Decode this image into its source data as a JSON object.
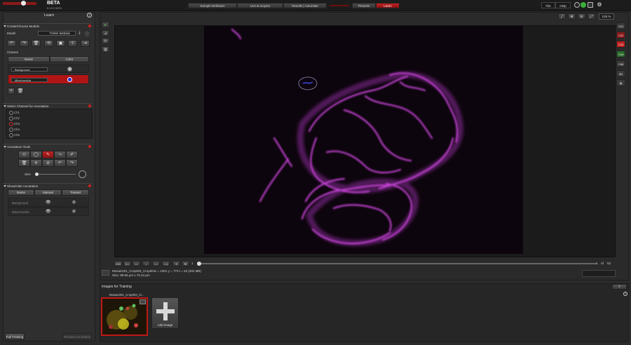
{
  "app": {
    "beta": "BETA",
    "version": "0.13.2.5074",
    "title": "Learn"
  },
  "workflow": {
    "steps": [
      "Sample Definition",
      "Live & Acquire",
      "Results | Automate"
    ],
    "modes": [
      "Process",
      "Learn"
    ],
    "active_mode": "Learn"
  },
  "menu": {
    "file": "File",
    "help": "Help"
  },
  "left_panel": {
    "help": "?",
    "create_models": {
      "header": "Create/Choose Models",
      "model_label": "Model",
      "model_value": "THINK Website"
    },
    "classes": {
      "label": "Classes",
      "col_name": "Name",
      "col_color": "Color",
      "rows": [
        {
          "name": "Background",
          "color": "#b8b8b8"
        },
        {
          "name": "Mitochondria",
          "color": "#1f2fd8"
        }
      ]
    },
    "channel_select": {
      "header": "Select Channel for Annotation",
      "channels": [
        "Ch1",
        "Ch2",
        "Ch3",
        "Ch4",
        "Ch5"
      ],
      "selected": "Ch3"
    },
    "annotation_tools": {
      "header": "Annotation Tools",
      "size_label": "Size"
    },
    "show_hide": {
      "header": "Show/Hide Annotation",
      "col_name": "Name",
      "col_manual": "Manual",
      "col_trained": "Trained",
      "rows": [
        "Background",
        "Mitochondria"
      ]
    },
    "buttons": {
      "full_training": "Full Training",
      "preview": "Preview Annotation"
    }
  },
  "viewer": {
    "zoom": "126 %",
    "channels": [
      "Ch1",
      "Ch2",
      "Ch3",
      "Ch4",
      "Ch5",
      "3D"
    ],
    "channel_colors": [
      "#3a3a3a",
      "#8a1a1a",
      "#c02020",
      "#2a6a2a",
      "#3a3a3a",
      "#3a3a3a"
    ],
    "player": [
      "1/20",
      "|<<",
      "<<",
      ">",
      ">>",
      ">>|"
    ],
    "frame_start": "1",
    "frame_pos": "1",
    "frame_of": "of",
    "frame_total": "53",
    "file_name": "Mosaic001_Crop003_Crop001",
    "coords": "x = 1001 y = 773 t = 53 (402 MB)",
    "size": "Size: 98.55 µm x 70.44 µm"
  },
  "training": {
    "header": "Images for Training",
    "thumb_label": "Mosaic001_Crop003_Cr...",
    "add_image": "Add Image"
  },
  "colors": {
    "accent": "#c01818",
    "magenta": "#c040d0"
  }
}
